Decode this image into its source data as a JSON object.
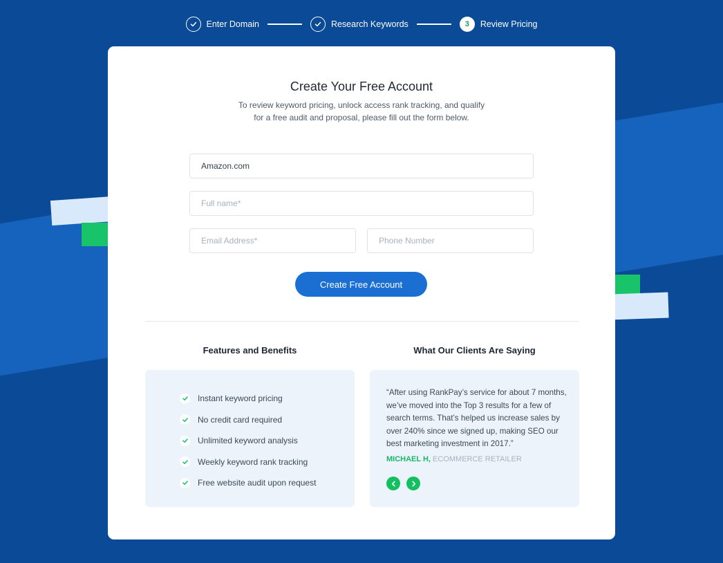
{
  "stepper": {
    "steps": [
      {
        "label": "Enter Domain",
        "state": "done"
      },
      {
        "label": "Research Keywords",
        "state": "done"
      },
      {
        "label": "Review Pricing",
        "state": "current",
        "number": "3"
      }
    ]
  },
  "form": {
    "title": "Create Your Free Account",
    "subtitle_line1": "To review keyword pricing, unlock access rank tracking, and qualify",
    "subtitle_line2": "for a free audit and proposal, please fill out the form below.",
    "domain_value": "Amazon.com",
    "fullname_placeholder": "Full name*",
    "email_placeholder": "Email Address*",
    "phone_placeholder": "Phone Number",
    "submit_label": "Create Free Account"
  },
  "features": {
    "heading": "Features and Benefits",
    "items": [
      "Instant keyword pricing",
      "No credit card required",
      "Unlimited keyword analysis",
      "Weekly keyword rank tracking",
      "Free website audit upon request"
    ]
  },
  "testimonials": {
    "heading": "What Our Clients Are Saying",
    "quote": "“After using RankPay’s service for about 7 months, we’ve moved into the Top 3 results for a few of search terms. That’s helped us increase sales by over 240% since we signed up, making SEO our best marketing investment in 2017.”",
    "author": "MICHAEL H,",
    "role": "ECOMMERCE RETAILER"
  },
  "colors": {
    "background": "#0a4a96",
    "band": "#1663bd",
    "accent_green": "#19c36a",
    "button_blue": "#1b6fd3"
  }
}
